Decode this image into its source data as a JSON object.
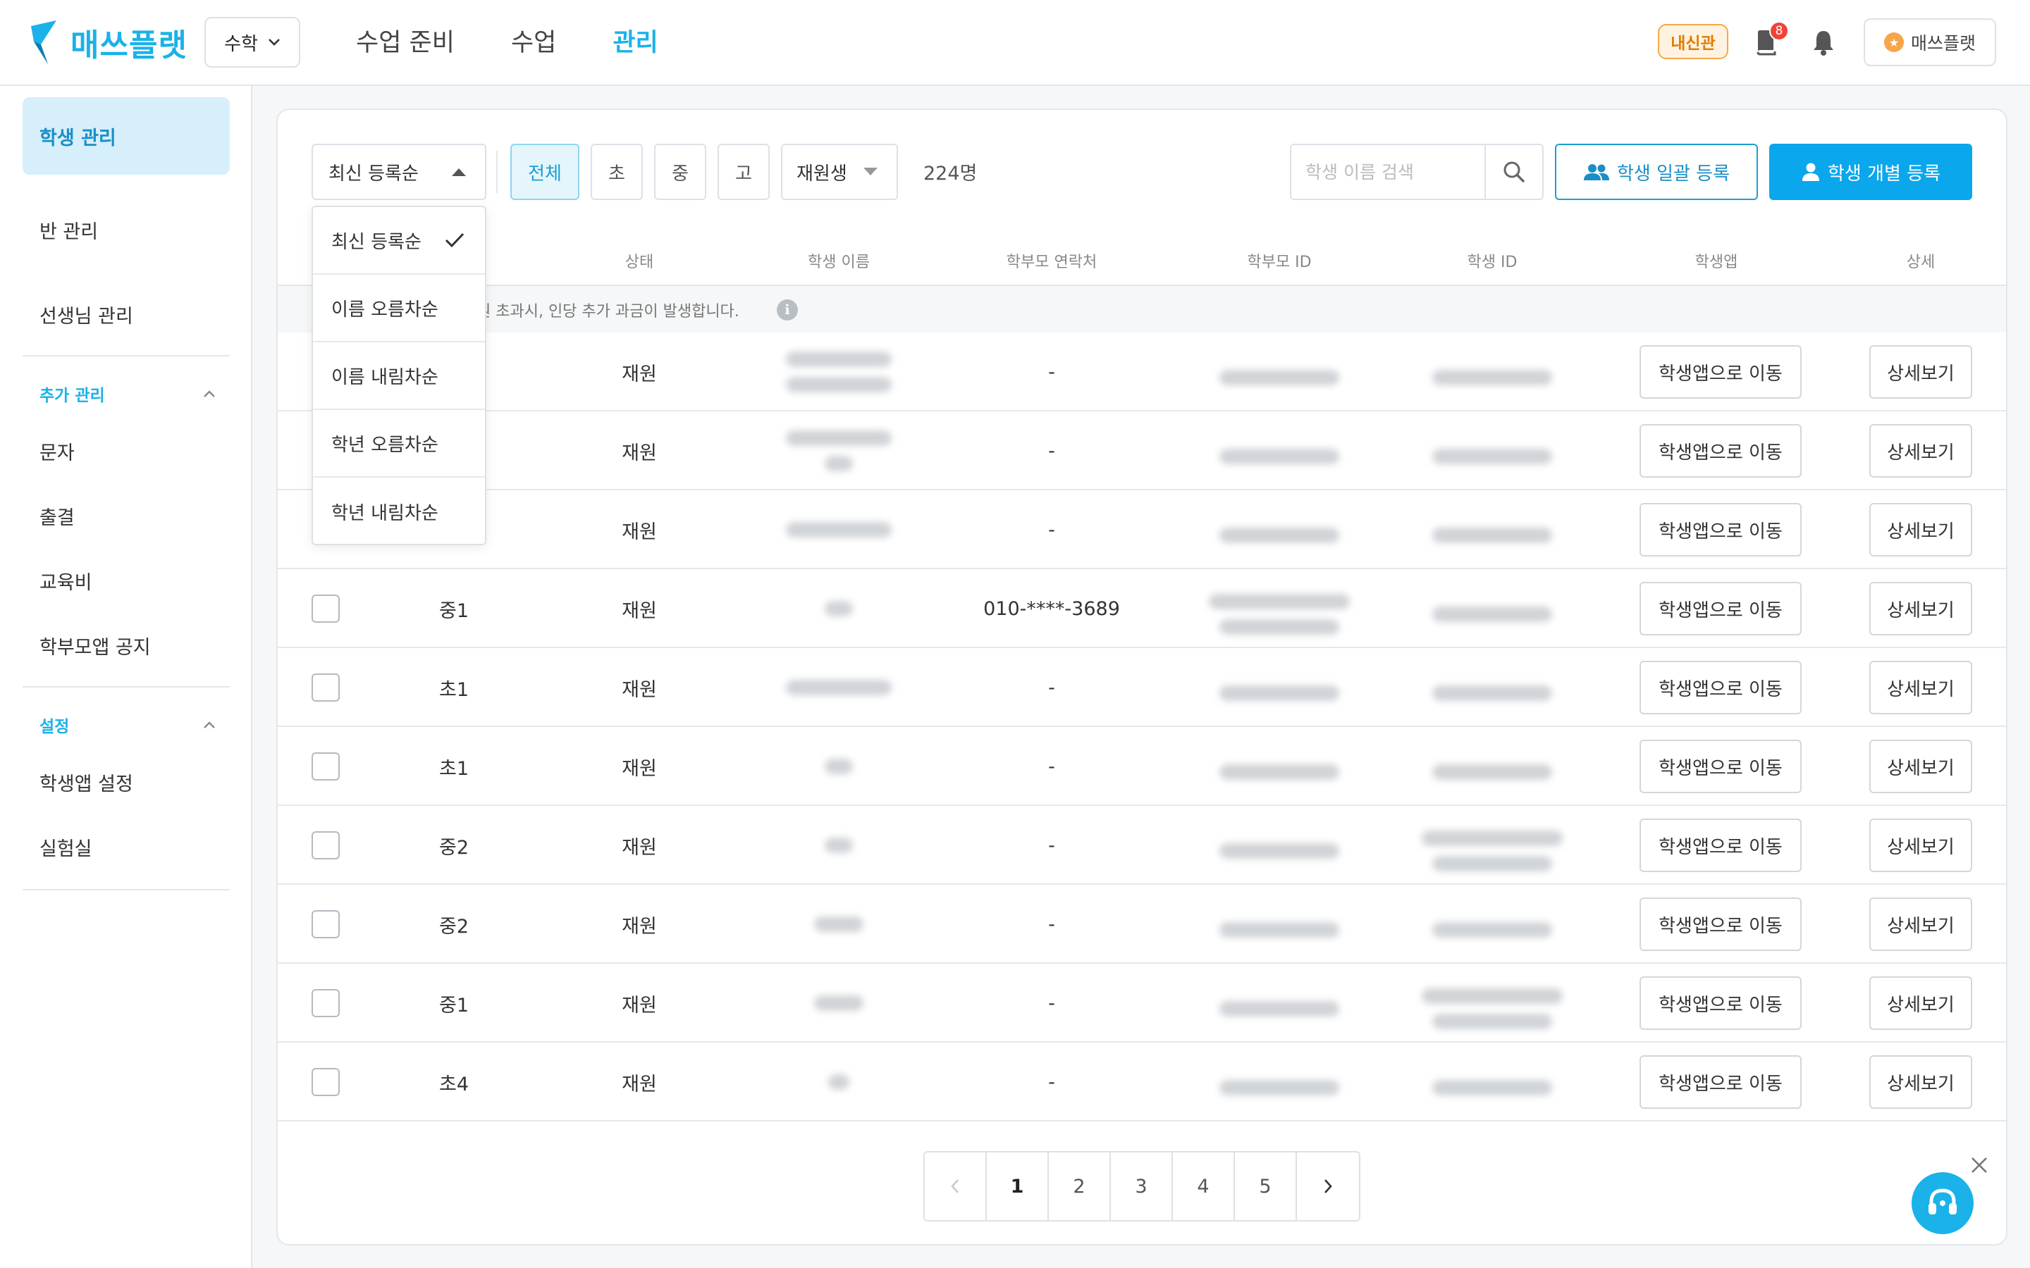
{
  "header": {
    "logo_text": "매쓰플랫",
    "subject": "수학",
    "nav": [
      {
        "label": "수업 준비"
      },
      {
        "label": "수업"
      },
      {
        "label": "관리"
      }
    ],
    "naesin_badge": "내신관",
    "notification_count": "8",
    "profile_name": "매쓰플랫",
    "profile_initial": "★"
  },
  "sidebar": {
    "items_top": [
      {
        "label": "학생 관리"
      },
      {
        "label": "반 관리"
      },
      {
        "label": "선생님 관리"
      }
    ],
    "extra_section": {
      "title": "추가 관리"
    },
    "extra_items": [
      {
        "label": "문자"
      },
      {
        "label": "출결"
      },
      {
        "label": "교육비"
      },
      {
        "label": "학부모앱 공지"
      }
    ],
    "settings_section": {
      "title": "설정"
    },
    "settings_items": [
      {
        "label": "학생앱 설정"
      },
      {
        "label": "실험실"
      }
    ]
  },
  "toolbar": {
    "sort_selected": "최신 등록순",
    "filters": [
      "전체",
      "초",
      "중",
      "고"
    ],
    "status_filter": "재원생",
    "count": "224명",
    "search_placeholder": "학생 이름 검색",
    "bulk_register": "학생 일괄 등록",
    "single_register": "학생 개별 등록"
  },
  "sort_options": [
    {
      "label": "최신 등록순",
      "checked": true
    },
    {
      "label": "이름 오름차순"
    },
    {
      "label": "이름 내림차순"
    },
    {
      "label": "학년 오름차순"
    },
    {
      "label": "학년 내림차순"
    }
  ],
  "table": {
    "columns": [
      "상태",
      "학생 이름",
      "학부모 연락처",
      "학부모 ID",
      "학생 ID",
      "학생앱",
      "상세"
    ],
    "notice": "원 초과시, 인당 추가 과금이 발생합니다.",
    "info_icon": "i",
    "app_button_label": "학생앱으로 이동",
    "detail_button_label": "상세보기",
    "rows": [
      {
        "grade": "",
        "status": "재원",
        "parent_phone": "-"
      },
      {
        "grade": "",
        "status": "재원",
        "parent_phone": "-"
      },
      {
        "grade": "",
        "status": "재원",
        "parent_phone": "-"
      },
      {
        "grade": "중1",
        "status": "재원",
        "parent_phone": "010-****-3689"
      },
      {
        "grade": "초1",
        "status": "재원",
        "parent_phone": "-"
      },
      {
        "grade": "초1",
        "status": "재원",
        "parent_phone": "-"
      },
      {
        "grade": "중2",
        "status": "재원",
        "parent_phone": "-"
      },
      {
        "grade": "중2",
        "status": "재원",
        "parent_phone": "-"
      },
      {
        "grade": "중1",
        "status": "재원",
        "parent_phone": "-"
      },
      {
        "grade": "초4",
        "status": "재원",
        "parent_phone": "-"
      }
    ]
  },
  "pagination": {
    "pages": [
      "1",
      "2",
      "3",
      "4",
      "5"
    ],
    "current": "1"
  },
  "colors": {
    "brand": "#1ab2e8",
    "primary_button": "#0aa7ec",
    "badge": "#f2a94a"
  }
}
